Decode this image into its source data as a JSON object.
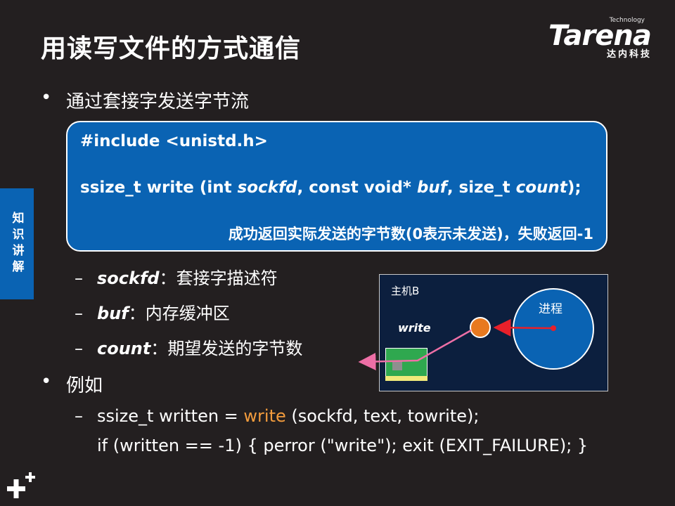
{
  "slide": {
    "title": "用读写文件的方式通信"
  },
  "logo": {
    "tech": "Technology",
    "brand": "Tarena",
    "sub": "达内科技"
  },
  "side_tab": {
    "label": "知识讲解"
  },
  "bullets": {
    "first": "通过套接字发送字节流",
    "second": "例如"
  },
  "code_box": {
    "include_line": "#include <unistd.h>",
    "sig_prefix": "ssize_t write (int ",
    "sig_p1": "sockfd",
    "sig_mid1": ", const void* ",
    "sig_p2": "buf",
    "sig_mid2": ", size_t ",
    "sig_p3": "count",
    "sig_suffix": ");",
    "note": "成功返回实际发送的字节数(0表示未发送)，失败返回-1"
  },
  "params": [
    {
      "name": "sockfd",
      "desc": "：套接字描述符"
    },
    {
      "name": "buf",
      "desc": "：内存缓冲区"
    },
    {
      "name": "count",
      "desc": "：期望发送的字节数"
    }
  ],
  "diagram": {
    "host_label": "主机B",
    "write_label": "write",
    "process_label": "进程",
    "colors": {
      "arrow": "#e8202a",
      "line": "#ee6fa6",
      "write_dot": "#e8791f",
      "process": "#0a63b3"
    }
  },
  "example": {
    "dash": "–",
    "line1_prefix": "ssize_t written = ",
    "line1_kw": "write",
    "line1_suffix": " (sockfd, text, towrite);",
    "line2": "if (written == -1) { perror (\"write\"); exit (EXIT_FAILURE); }"
  },
  "colors": {
    "background": "#231f20",
    "accent_blue": "#0a63b3",
    "keyword_orange": "#f39c3d"
  }
}
